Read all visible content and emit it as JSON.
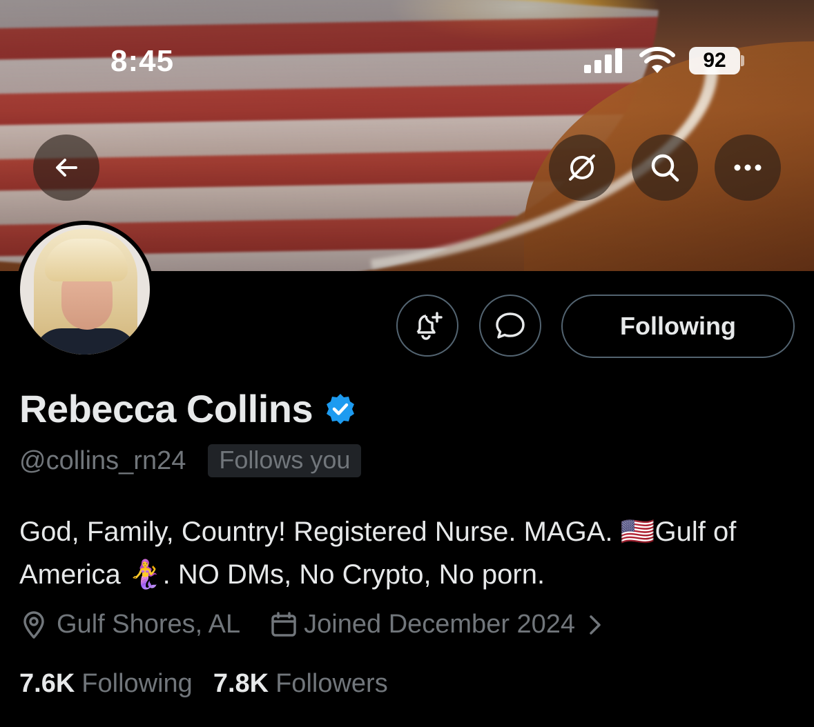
{
  "status_bar": {
    "time": "8:45",
    "battery": "92"
  },
  "nav": {
    "back_icon": "arrow-left-icon",
    "grok_icon": "grok-icon",
    "search_icon": "search-icon",
    "more_icon": "more-horizontal-icon"
  },
  "profile": {
    "display_name": "Rebecca Collins",
    "handle": "@collins_rn24",
    "follows_you": "Follows you",
    "bio_before_flag": "God, Family, Country! Registered Nurse. MAGA. ",
    "flag_emoji": "🇺🇸",
    "bio_mid": "Gulf of America ",
    "mermaid_emoji": "🧜‍♀️",
    "bio_after": ". NO DMs, No Crypto, No porn.",
    "location": "Gulf Shores, AL",
    "joined": "Joined December 2024",
    "following_count": "7.6K",
    "following_label": "Following",
    "followers_count": "7.8K",
    "followers_label": "Followers"
  },
  "actions": {
    "follow_state_label": "Following",
    "notify_icon": "bell-plus-icon",
    "message_icon": "message-bubble-icon"
  },
  "colors": {
    "background": "#000000",
    "primary_text": "#e7e9ea",
    "secondary_text": "#71767b",
    "verified_blue": "#1d9bf0",
    "border": "#536471"
  }
}
